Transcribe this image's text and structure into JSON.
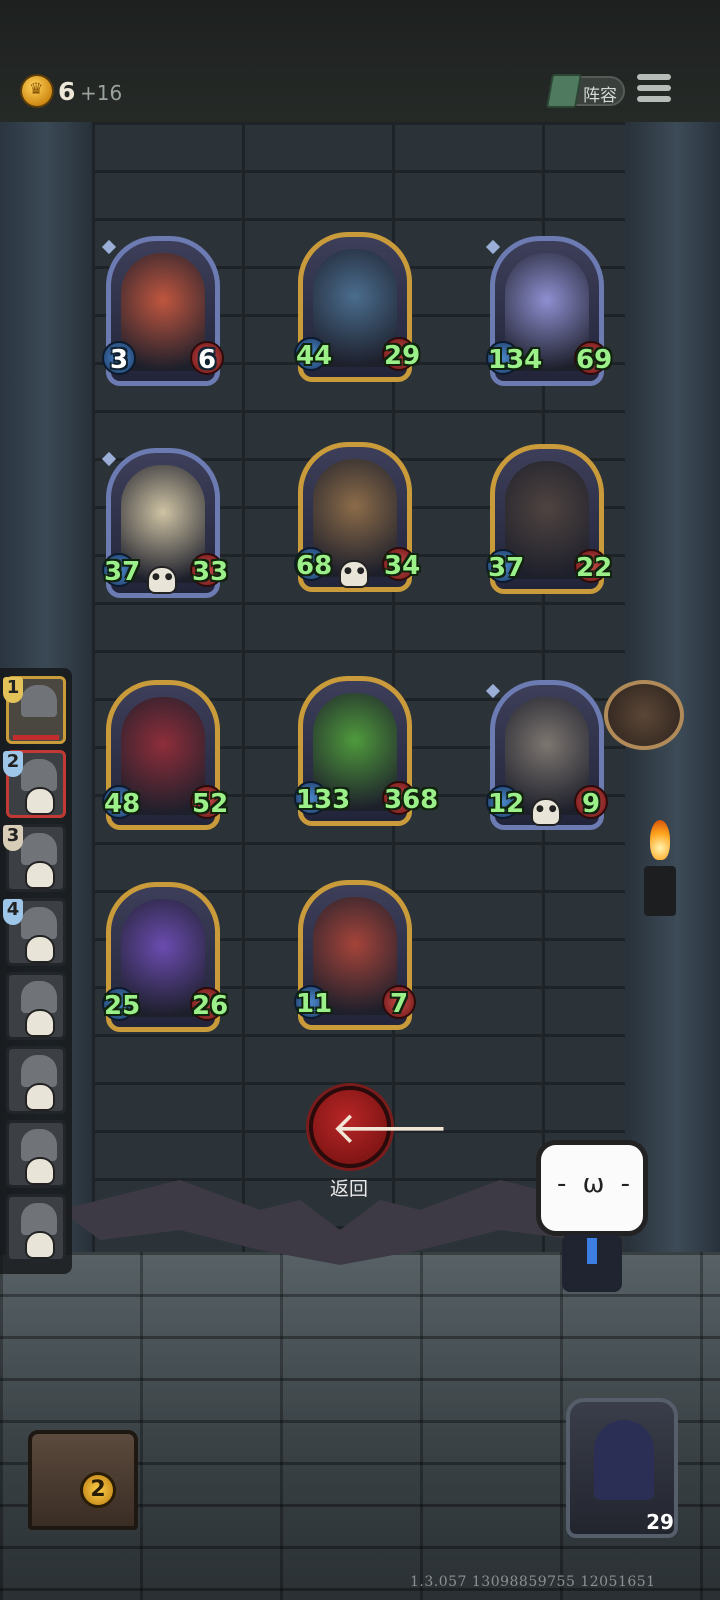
{
  "header": {
    "gold_amount": "6",
    "gold_income": "+16",
    "lineup_label": "阵容"
  },
  "board": {
    "units": [
      {
        "name": "red-haired-oracle",
        "attack": "3",
        "health": "6",
        "frame": "blue",
        "stat_color": "white"
      },
      {
        "name": "blue-elf-sorceress",
        "attack": "44",
        "health": "29",
        "frame": "gold",
        "stat_color": "green"
      },
      {
        "name": "harpist-maiden",
        "attack": "134",
        "health": "69",
        "frame": "blue",
        "stat_color": "green"
      },
      {
        "name": "bone-dragon",
        "attack": "37",
        "health": "33",
        "frame": "blue",
        "stat_color": "green",
        "deathrattle": true
      },
      {
        "name": "detective-girl",
        "attack": "68",
        "health": "34",
        "frame": "gold",
        "stat_color": "green",
        "deathrattle": true
      },
      {
        "name": "stone-golem",
        "attack": "37",
        "health": "22",
        "frame": "gold",
        "stat_color": "green"
      },
      {
        "name": "red-dragon",
        "attack": "48",
        "health": "52",
        "frame": "gold",
        "stat_color": "green"
      },
      {
        "name": "green-baby-dragon",
        "attack": "133",
        "health": "368",
        "frame": "gold",
        "stat_color": "green"
      },
      {
        "name": "old-scholar",
        "attack": "12",
        "health": "9",
        "frame": "blue",
        "stat_color": "green",
        "deathrattle": true
      },
      {
        "name": "purple-dragon",
        "attack": "25",
        "health": "26",
        "frame": "gold",
        "stat_color": "green"
      },
      {
        "name": "horned-girl",
        "attack": "11",
        "health": "7",
        "frame": "gold",
        "stat_color": "green"
      }
    ]
  },
  "timeline": {
    "turns": [
      {
        "label": "1",
        "state": "active"
      },
      {
        "label": "2",
        "state": "selected"
      },
      {
        "label": "3",
        "state": "normal"
      },
      {
        "label": "4",
        "state": "normal"
      },
      {
        "label": "",
        "state": "normal"
      },
      {
        "label": "",
        "state": "normal"
      },
      {
        "label": "",
        "state": "normal"
      },
      {
        "label": "",
        "state": "normal"
      }
    ]
  },
  "back_button": {
    "label": "返回"
  },
  "chest": {
    "count": "2"
  },
  "hero": {
    "health": "29"
  },
  "footer": {
    "version_text": "1.3.057 13098859755 12051651"
  },
  "colors": {
    "accent_gold": "#c99b3a",
    "back_red": "#b82626",
    "stat_green": "#9cf08a"
  }
}
